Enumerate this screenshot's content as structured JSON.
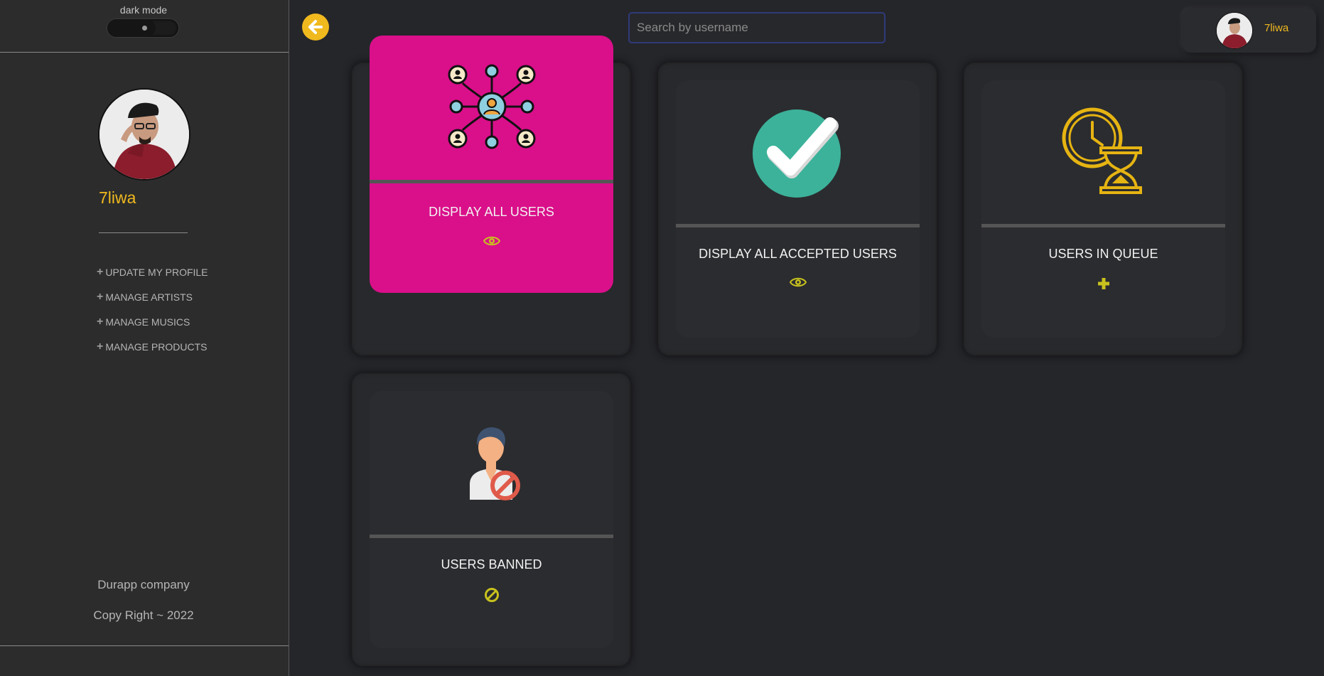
{
  "sidebar": {
    "dark_mode_label": "dark mode",
    "profile_name": "7liwa",
    "menu": [
      {
        "label": "UPDATE MY PROFILE",
        "icon": "plus-icon"
      },
      {
        "label": "MANAGE ARTISTS",
        "icon": "plus-icon"
      },
      {
        "label": "MANAGE MUSICS",
        "icon": "plus-icon"
      },
      {
        "label": "MANAGE PRODUCTS",
        "icon": "plus-icon"
      }
    ],
    "footer_company": "Durapp company",
    "footer_copyright": "Copy Right ~ 2022"
  },
  "header": {
    "back_icon": "arrow-left-icon",
    "search_placeholder": "Search by username",
    "search_value": "",
    "user_name": "7liwa"
  },
  "cards": [
    {
      "title": "DISPLAY ALL USERS",
      "icon": "users-network-icon",
      "action_icon": "eye-icon",
      "highlighted": true
    },
    {
      "title": "DISPLAY ALL ACCEPTED USERS",
      "icon": "check-circle-icon",
      "action_icon": "eye-icon"
    },
    {
      "title": "USERS IN QUEUE",
      "icon": "clock-hourglass-icon",
      "action_icon": "plus-icon"
    },
    {
      "title": "USERS BANNED",
      "icon": "banned-user-icon",
      "action_icon": "ban-icon"
    }
  ],
  "colors": {
    "accent": "#f0b91e",
    "highlight_card": "#da0f8a",
    "action_icon": "#c8c21e",
    "check_circle": "#3cb29a"
  }
}
